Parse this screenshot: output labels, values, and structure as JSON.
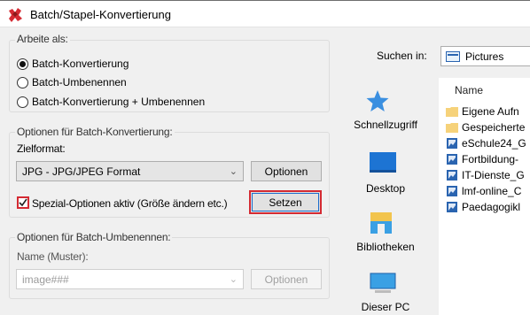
{
  "window": {
    "title": "Batch/Stapel-Konvertierung"
  },
  "work_as": {
    "legend": "Arbeite als:",
    "options": [
      {
        "label": "Batch-Konvertierung",
        "checked": true
      },
      {
        "label": "Batch-Umbenennen",
        "checked": false
      },
      {
        "label": "Batch-Konvertierung + Umbenennen",
        "checked": false
      }
    ]
  },
  "convert_options": {
    "legend": "Optionen für Batch-Konvertierung:",
    "target_label": "Zielformat:",
    "format_value": "JPG - JPG/JPEG Format",
    "options_button": "Optionen",
    "special_checkbox_label": "Spezial-Optionen aktiv (Größe ändern etc.)",
    "special_checked": true,
    "set_button": "Setzen"
  },
  "rename_options": {
    "legend": "Optionen für Batch-Umbenennen:",
    "name_label": "Name (Muster):",
    "name_value": "image###",
    "options_button": "Optionen"
  },
  "browser": {
    "look_in_label": "Suchen in:",
    "look_in_value": "Pictures",
    "places": [
      "Schnellzugriff",
      "Desktop",
      "Bibliotheken",
      "Dieser PC"
    ],
    "column_name": "Name",
    "files": [
      {
        "name": "Eigene Aufn",
        "type": "folder"
      },
      {
        "name": "Gespeicherte",
        "type": "folder"
      },
      {
        "name": "eSchule24_G",
        "type": "image"
      },
      {
        "name": "Fortbildung-",
        "type": "image"
      },
      {
        "name": "IT-Dienste_G",
        "type": "image"
      },
      {
        "name": "lmf-online_C",
        "type": "image"
      },
      {
        "name": "Paedagogikl",
        "type": "image"
      }
    ]
  },
  "colors": {
    "highlight_red": "#d42a32",
    "focus_blue": "#1a6dcc",
    "folder_yellow": "#f6d27a",
    "image_blue": "#2a64b0"
  }
}
